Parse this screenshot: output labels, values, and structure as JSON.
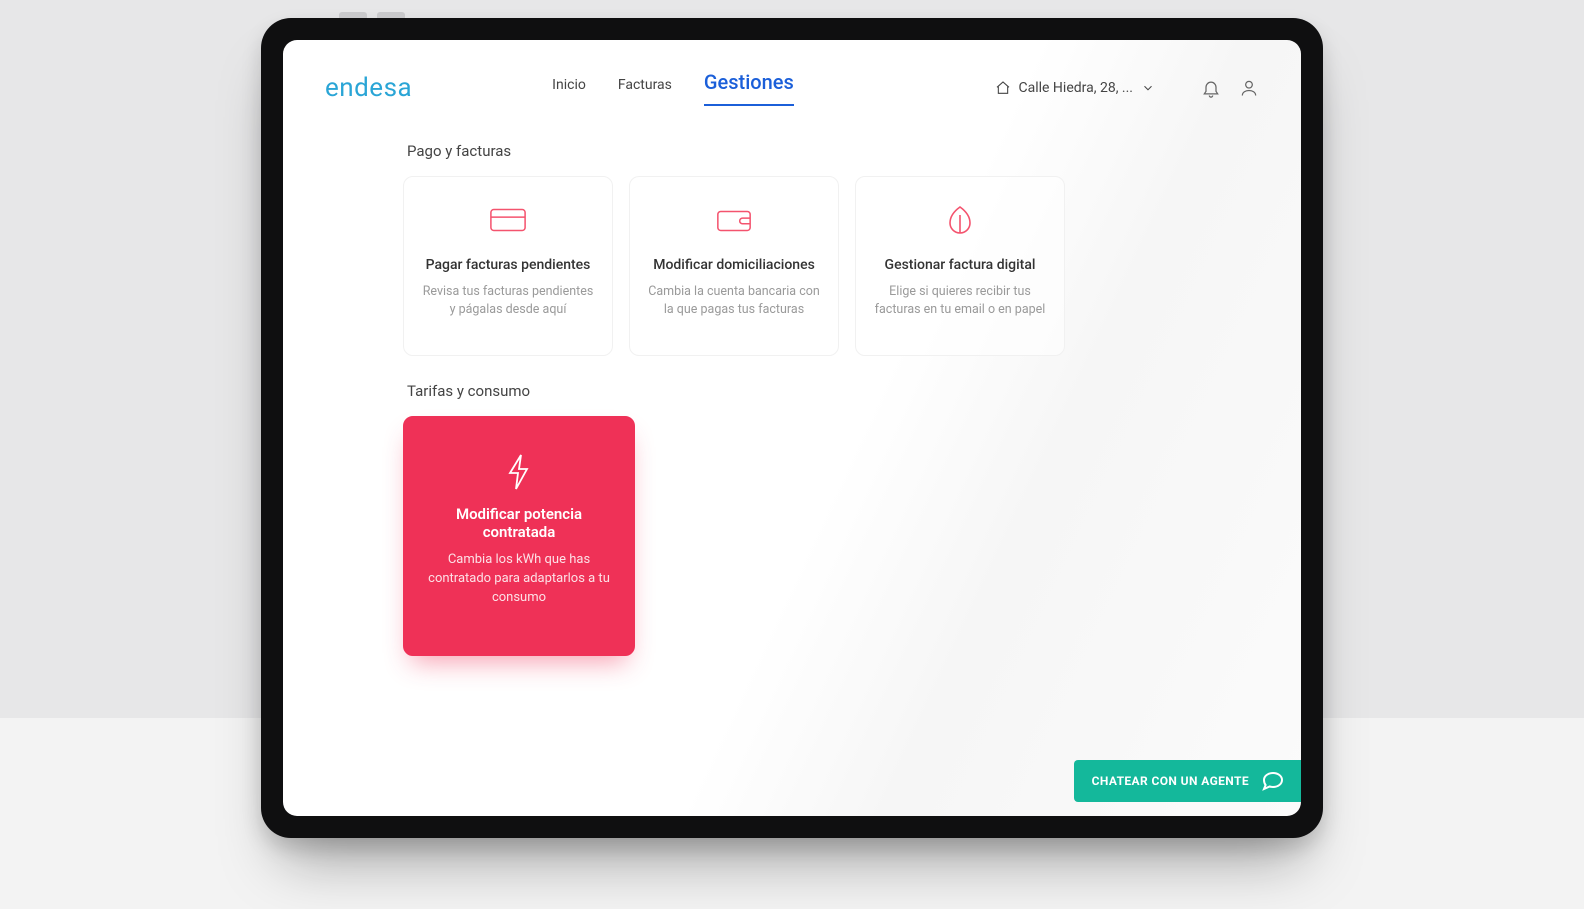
{
  "brand": "endesa",
  "nav": {
    "items": [
      {
        "label": "Inicio",
        "active": false
      },
      {
        "label": "Facturas",
        "active": false
      },
      {
        "label": "Gestiones",
        "active": true
      }
    ]
  },
  "address": {
    "label": "Calle Hiedra, 28, ..."
  },
  "sections": {
    "pago": {
      "title": "Pago y facturas",
      "cards": [
        {
          "title": "Pagar facturas pendientes",
          "desc": "Revisa tus facturas pendientes y págalas desde aquí"
        },
        {
          "title": "Modificar domiciliaciones",
          "desc": "Cambia la cuenta bancaria con la que pagas tus facturas"
        },
        {
          "title": "Gestionar factura digital",
          "desc": "Elige si quieres recibir tus facturas en tu email o en papel"
        }
      ]
    },
    "tarifas": {
      "title": "Tarifas y consumo",
      "cards": [
        {
          "title": "Modificar potencia contratada",
          "desc": "Cambia los kWh que has contratado para adaptarlos a tu consumo",
          "active": true
        }
      ]
    }
  },
  "chat": {
    "label": "CHATEAR CON UN AGENTE"
  }
}
